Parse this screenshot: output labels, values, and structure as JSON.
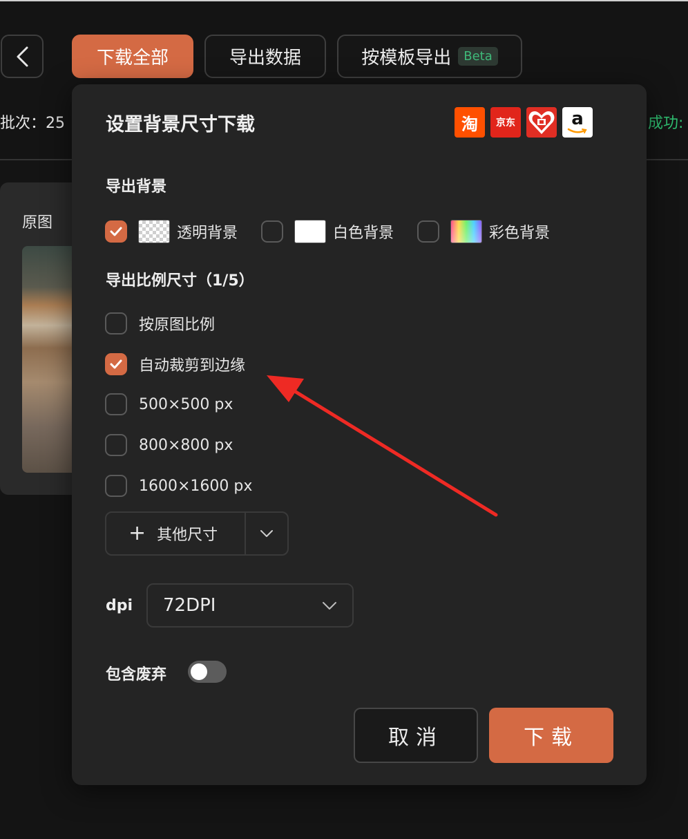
{
  "toolbar": {
    "download_all": "下载全部",
    "export_data": "导出数据",
    "template_export": "按模板导出",
    "beta_badge": "Beta"
  },
  "status": {
    "batch": "批次：25",
    "success": "成功:"
  },
  "card": {
    "title": "原图"
  },
  "dialog": {
    "title": "设置背景尺寸下载",
    "platforms": {
      "taobao": "淘",
      "jd": "京东",
      "pdd": "拼多多",
      "amazon": "a"
    },
    "export_bg_label": "导出背景",
    "bg_options": [
      {
        "label": "透明背景",
        "checked": true
      },
      {
        "label": "白色背景",
        "checked": false
      },
      {
        "label": "彩色背景",
        "checked": false
      }
    ],
    "size_label": "导出比例尺寸（1/5）",
    "size_options": [
      {
        "label": "按原图比例",
        "checked": false
      },
      {
        "label": "自动裁剪到边缘",
        "checked": true
      },
      {
        "label": "500×500 px",
        "checked": false
      },
      {
        "label": "800×800 px",
        "checked": false
      },
      {
        "label": "1600×1600 px",
        "checked": false
      }
    ],
    "other_size": "其他尺寸",
    "dpi_label": "dpi",
    "dpi_value": "72DPI",
    "include_discarded_label": "包含废弃",
    "include_discarded": false,
    "cancel": "取消",
    "download": "下载"
  },
  "colors": {
    "accent": "#d46a44",
    "success": "#2fbf71",
    "beta": "#3fb979",
    "annotation_arrow": "#ee2a24"
  }
}
